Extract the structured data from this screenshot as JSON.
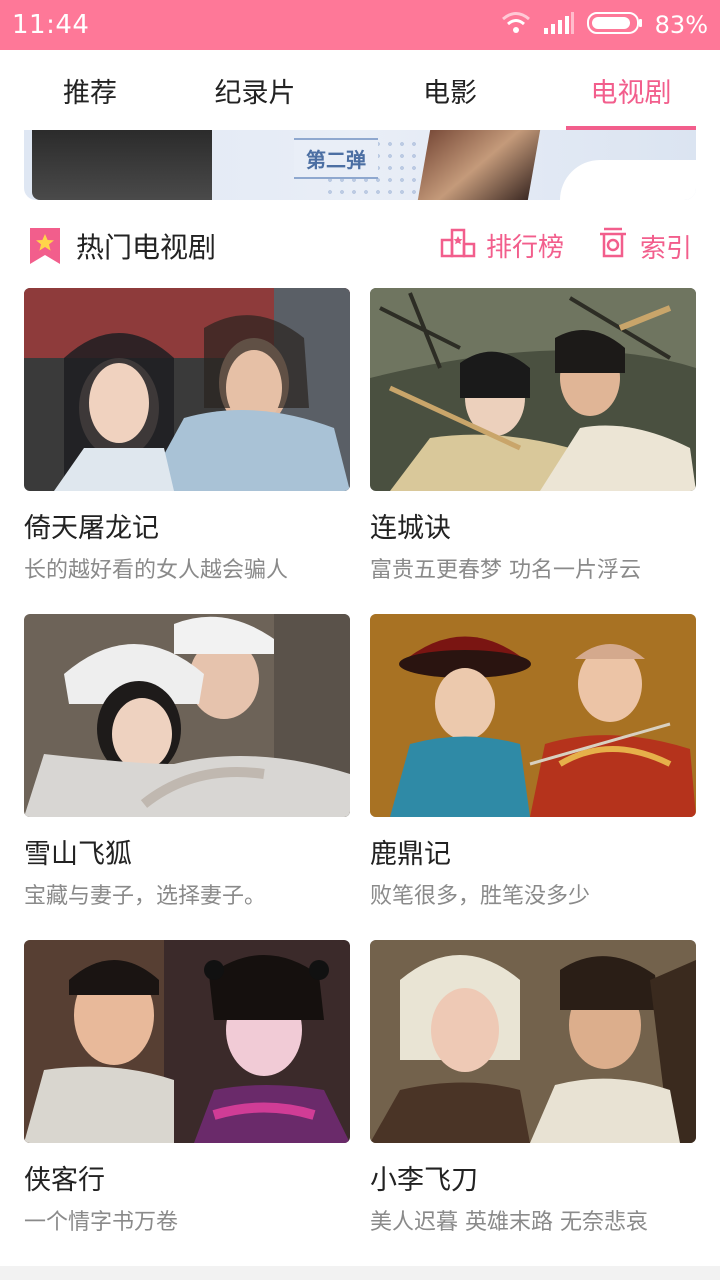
{
  "status_bar": {
    "time": "11:44",
    "battery": "83%",
    "icons": [
      "wifi-icon",
      "signal-icon",
      "battery-icon"
    ]
  },
  "tabs": [
    {
      "label": "推荐",
      "active": false
    },
    {
      "label": "纪录片",
      "active": false
    },
    {
      "label": "电影",
      "active": false
    },
    {
      "label": "电视剧",
      "active": true
    }
  ],
  "banner": {
    "badge": "第二弹",
    "page_count": 3,
    "active_page": 3
  },
  "section": {
    "title": "热门电视剧",
    "ranking_label": "排行榜",
    "index_label": "索引",
    "icons": [
      "bookmark-star-icon",
      "ranking-icon",
      "index-icon"
    ]
  },
  "shows": [
    {
      "title": "倚天屠龙记",
      "desc": "长的越好看的女人越会骗人"
    },
    {
      "title": "连城诀",
      "desc": "富贵五更春梦 功名一片浮云"
    },
    {
      "title": "雪山飞狐",
      "desc": "宝藏与妻子，选择妻子。"
    },
    {
      "title": "鹿鼎记",
      "desc": "败笔很多，胜笔没多少"
    },
    {
      "title": "侠客行",
      "desc": "一个情字书万卷"
    },
    {
      "title": "小李飞刀",
      "desc": "美人迟暮 英雄末路 无奈悲哀"
    }
  ],
  "colors": {
    "accent": "#f25e8c",
    "status_bar": "#fe7898",
    "subtitle_gray": "#8a8a8a"
  }
}
